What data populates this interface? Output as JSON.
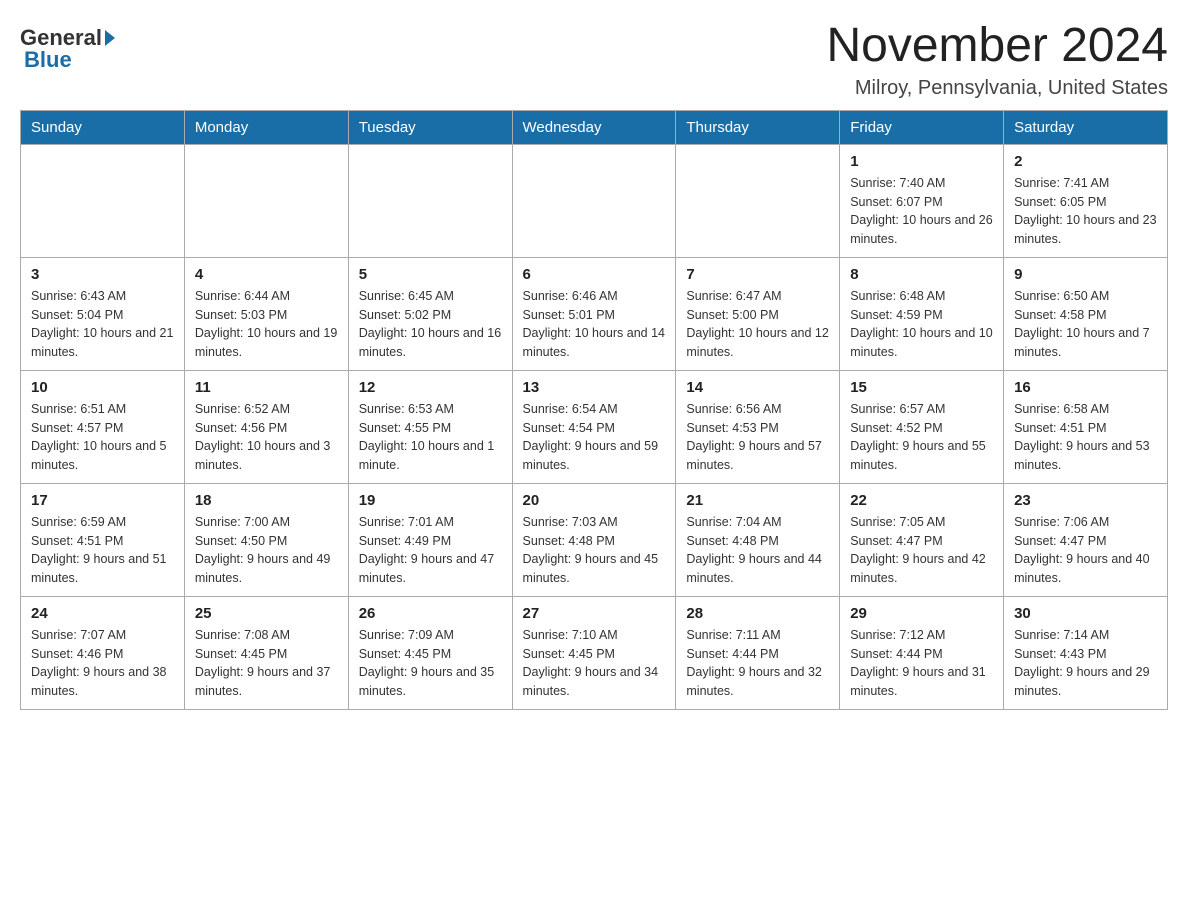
{
  "header": {
    "logo_text_general": "General",
    "logo_text_blue": "Blue",
    "month_title": "November 2024",
    "location": "Milroy, Pennsylvania, United States"
  },
  "weekdays": [
    "Sunday",
    "Monday",
    "Tuesday",
    "Wednesday",
    "Thursday",
    "Friday",
    "Saturday"
  ],
  "weeks": [
    [
      {
        "day": "",
        "info": ""
      },
      {
        "day": "",
        "info": ""
      },
      {
        "day": "",
        "info": ""
      },
      {
        "day": "",
        "info": ""
      },
      {
        "day": "",
        "info": ""
      },
      {
        "day": "1",
        "info": "Sunrise: 7:40 AM\nSunset: 6:07 PM\nDaylight: 10 hours and 26 minutes."
      },
      {
        "day": "2",
        "info": "Sunrise: 7:41 AM\nSunset: 6:05 PM\nDaylight: 10 hours and 23 minutes."
      }
    ],
    [
      {
        "day": "3",
        "info": "Sunrise: 6:43 AM\nSunset: 5:04 PM\nDaylight: 10 hours and 21 minutes."
      },
      {
        "day": "4",
        "info": "Sunrise: 6:44 AM\nSunset: 5:03 PM\nDaylight: 10 hours and 19 minutes."
      },
      {
        "day": "5",
        "info": "Sunrise: 6:45 AM\nSunset: 5:02 PM\nDaylight: 10 hours and 16 minutes."
      },
      {
        "day": "6",
        "info": "Sunrise: 6:46 AM\nSunset: 5:01 PM\nDaylight: 10 hours and 14 minutes."
      },
      {
        "day": "7",
        "info": "Sunrise: 6:47 AM\nSunset: 5:00 PM\nDaylight: 10 hours and 12 minutes."
      },
      {
        "day": "8",
        "info": "Sunrise: 6:48 AM\nSunset: 4:59 PM\nDaylight: 10 hours and 10 minutes."
      },
      {
        "day": "9",
        "info": "Sunrise: 6:50 AM\nSunset: 4:58 PM\nDaylight: 10 hours and 7 minutes."
      }
    ],
    [
      {
        "day": "10",
        "info": "Sunrise: 6:51 AM\nSunset: 4:57 PM\nDaylight: 10 hours and 5 minutes."
      },
      {
        "day": "11",
        "info": "Sunrise: 6:52 AM\nSunset: 4:56 PM\nDaylight: 10 hours and 3 minutes."
      },
      {
        "day": "12",
        "info": "Sunrise: 6:53 AM\nSunset: 4:55 PM\nDaylight: 10 hours and 1 minute."
      },
      {
        "day": "13",
        "info": "Sunrise: 6:54 AM\nSunset: 4:54 PM\nDaylight: 9 hours and 59 minutes."
      },
      {
        "day": "14",
        "info": "Sunrise: 6:56 AM\nSunset: 4:53 PM\nDaylight: 9 hours and 57 minutes."
      },
      {
        "day": "15",
        "info": "Sunrise: 6:57 AM\nSunset: 4:52 PM\nDaylight: 9 hours and 55 minutes."
      },
      {
        "day": "16",
        "info": "Sunrise: 6:58 AM\nSunset: 4:51 PM\nDaylight: 9 hours and 53 minutes."
      }
    ],
    [
      {
        "day": "17",
        "info": "Sunrise: 6:59 AM\nSunset: 4:51 PM\nDaylight: 9 hours and 51 minutes."
      },
      {
        "day": "18",
        "info": "Sunrise: 7:00 AM\nSunset: 4:50 PM\nDaylight: 9 hours and 49 minutes."
      },
      {
        "day": "19",
        "info": "Sunrise: 7:01 AM\nSunset: 4:49 PM\nDaylight: 9 hours and 47 minutes."
      },
      {
        "day": "20",
        "info": "Sunrise: 7:03 AM\nSunset: 4:48 PM\nDaylight: 9 hours and 45 minutes."
      },
      {
        "day": "21",
        "info": "Sunrise: 7:04 AM\nSunset: 4:48 PM\nDaylight: 9 hours and 44 minutes."
      },
      {
        "day": "22",
        "info": "Sunrise: 7:05 AM\nSunset: 4:47 PM\nDaylight: 9 hours and 42 minutes."
      },
      {
        "day": "23",
        "info": "Sunrise: 7:06 AM\nSunset: 4:47 PM\nDaylight: 9 hours and 40 minutes."
      }
    ],
    [
      {
        "day": "24",
        "info": "Sunrise: 7:07 AM\nSunset: 4:46 PM\nDaylight: 9 hours and 38 minutes."
      },
      {
        "day": "25",
        "info": "Sunrise: 7:08 AM\nSunset: 4:45 PM\nDaylight: 9 hours and 37 minutes."
      },
      {
        "day": "26",
        "info": "Sunrise: 7:09 AM\nSunset: 4:45 PM\nDaylight: 9 hours and 35 minutes."
      },
      {
        "day": "27",
        "info": "Sunrise: 7:10 AM\nSunset: 4:45 PM\nDaylight: 9 hours and 34 minutes."
      },
      {
        "day": "28",
        "info": "Sunrise: 7:11 AM\nSunset: 4:44 PM\nDaylight: 9 hours and 32 minutes."
      },
      {
        "day": "29",
        "info": "Sunrise: 7:12 AM\nSunset: 4:44 PM\nDaylight: 9 hours and 31 minutes."
      },
      {
        "day": "30",
        "info": "Sunrise: 7:14 AM\nSunset: 4:43 PM\nDaylight: 9 hours and 29 minutes."
      }
    ]
  ]
}
